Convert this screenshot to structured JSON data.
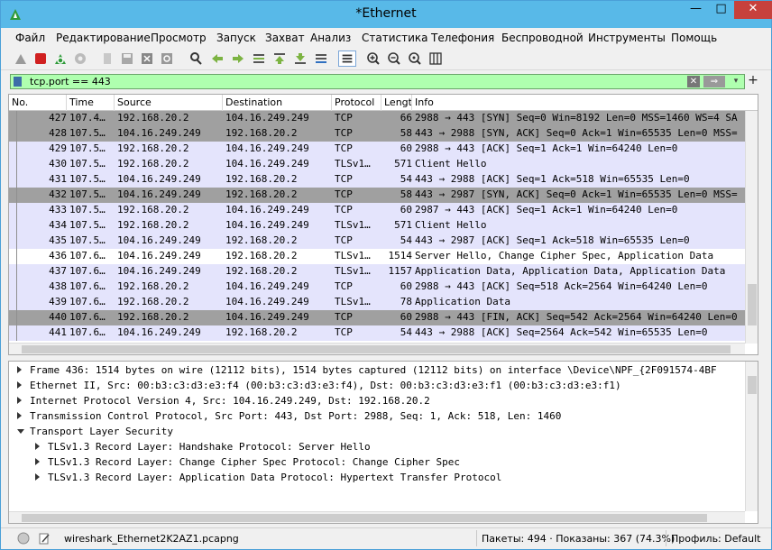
{
  "window": {
    "title": "*Ethernet",
    "minimize": "—",
    "maximize": "□",
    "close": "✕"
  },
  "menu": [
    "Файл",
    "Редактирование",
    "Просмотр",
    "Запуск",
    "Захват",
    "Анализ",
    "Статистика",
    "Телефония",
    "Беспроводной",
    "Инструменты",
    "Помощь"
  ],
  "toolbar_icons": [
    "shark-fin-start-icon",
    "stop-icon",
    "restart-icon",
    "options-icon",
    "open-file-icon",
    "save-icon",
    "close-file-icon",
    "reload-icon",
    "find-icon",
    "back-icon",
    "forward-icon",
    "go-to-packet-icon",
    "first-packet-icon",
    "last-packet-icon",
    "autoscroll-icon",
    "colorize-icon",
    "zoom-in-icon",
    "zoom-out-icon",
    "zoom-reset-icon",
    "resize-columns-icon"
  ],
  "filter": {
    "value": "tcp.port == 443",
    "clear": "✕",
    "apply": "⇒",
    "dropdown": "▾",
    "add": "+"
  },
  "columns": [
    "No.",
    "Time",
    "Source",
    "Destination",
    "Protocol",
    "Lengt",
    "Info"
  ],
  "packets": [
    {
      "no": "427",
      "time": "107.4…",
      "src": "192.168.20.2",
      "dst": "104.16.249.249",
      "proto": "TCP",
      "len": "66",
      "info": "2988 → 443 [SYN] Seq=0 Win=8192 Len=0 MSS=1460 WS=4 SA",
      "style": "dark"
    },
    {
      "no": "428",
      "time": "107.5…",
      "src": "104.16.249.249",
      "dst": "192.168.20.2",
      "proto": "TCP",
      "len": "58",
      "info": "443 → 2988 [SYN, ACK] Seq=0 Ack=1 Win=65535 Len=0 MSS=",
      "style": "dark"
    },
    {
      "no": "429",
      "time": "107.5…",
      "src": "192.168.20.2",
      "dst": "104.16.249.249",
      "proto": "TCP",
      "len": "60",
      "info": "2988 → 443 [ACK] Seq=1 Ack=1 Win=64240 Len=0",
      "style": "normal"
    },
    {
      "no": "430",
      "time": "107.5…",
      "src": "192.168.20.2",
      "dst": "104.16.249.249",
      "proto": "TLSv1…",
      "len": "571",
      "info": "Client Hello",
      "style": "normal"
    },
    {
      "no": "431",
      "time": "107.5…",
      "src": "104.16.249.249",
      "dst": "192.168.20.2",
      "proto": "TCP",
      "len": "54",
      "info": "443 → 2988 [ACK] Seq=1 Ack=518 Win=65535 Len=0",
      "style": "normal"
    },
    {
      "no": "432",
      "time": "107.5…",
      "src": "104.16.249.249",
      "dst": "192.168.20.2",
      "proto": "TCP",
      "len": "58",
      "info": "443 → 2987 [SYN, ACK] Seq=0 Ack=1 Win=65535 Len=0 MSS=",
      "style": "dark"
    },
    {
      "no": "433",
      "time": "107.5…",
      "src": "192.168.20.2",
      "dst": "104.16.249.249",
      "proto": "TCP",
      "len": "60",
      "info": "2987 → 443 [ACK] Seq=1 Ack=1 Win=64240 Len=0",
      "style": "normal"
    },
    {
      "no": "434",
      "time": "107.5…",
      "src": "192.168.20.2",
      "dst": "104.16.249.249",
      "proto": "TLSv1…",
      "len": "571",
      "info": "Client Hello",
      "style": "normal"
    },
    {
      "no": "435",
      "time": "107.5…",
      "src": "104.16.249.249",
      "dst": "192.168.20.2",
      "proto": "TCP",
      "len": "54",
      "info": "443 → 2987 [ACK] Seq=1 Ack=518 Win=65535 Len=0",
      "style": "normal"
    },
    {
      "no": "436",
      "time": "107.6…",
      "src": "104.16.249.249",
      "dst": "192.168.20.2",
      "proto": "TLSv1…",
      "len": "1514",
      "info": "Server Hello, Change Cipher Spec, Application Data",
      "style": "selected"
    },
    {
      "no": "437",
      "time": "107.6…",
      "src": "104.16.249.249",
      "dst": "192.168.20.2",
      "proto": "TLSv1…",
      "len": "1157",
      "info": "Application Data, Application Data, Application Data",
      "style": "normal"
    },
    {
      "no": "438",
      "time": "107.6…",
      "src": "192.168.20.2",
      "dst": "104.16.249.249",
      "proto": "TCP",
      "len": "60",
      "info": "2988 → 443 [ACK] Seq=518 Ack=2564 Win=64240 Len=0",
      "style": "normal"
    },
    {
      "no": "439",
      "time": "107.6…",
      "src": "192.168.20.2",
      "dst": "104.16.249.249",
      "proto": "TLSv1…",
      "len": "78",
      "info": "Application Data",
      "style": "normal"
    },
    {
      "no": "440",
      "time": "107.6…",
      "src": "192.168.20.2",
      "dst": "104.16.249.249",
      "proto": "TCP",
      "len": "60",
      "info": "2988 → 443 [FIN, ACK] Seq=542 Ack=2564 Win=64240 Len=0",
      "style": "dark"
    },
    {
      "no": "441",
      "time": "107.6…",
      "src": "104.16.249.249",
      "dst": "192.168.20.2",
      "proto": "TCP",
      "len": "54",
      "info": "443 → 2988 [ACK] Seq=2564 Ack=542 Win=65535 Len=0",
      "style": "normal"
    }
  ],
  "details": [
    {
      "text": "Frame 436: 1514 bytes on wire (12112 bits), 1514 bytes captured (12112 bits) on interface \\Device\\NPF_{2F091574-4BF",
      "expanded": false
    },
    {
      "text": "Ethernet II, Src: 00:b3:c3:d3:e3:f4 (00:b3:c3:d3:e3:f4), Dst: 00:b3:c3:d3:e3:f1 (00:b3:c3:d3:e3:f1)",
      "expanded": false
    },
    {
      "text": "Internet Protocol Version 4, Src: 104.16.249.249, Dst: 192.168.20.2",
      "expanded": false
    },
    {
      "text": "Transmission Control Protocol, Src Port: 443, Dst Port: 2988, Seq: 1, Ack: 518, Len: 1460",
      "expanded": false
    },
    {
      "text": "Transport Layer Security",
      "expanded": true
    },
    {
      "text": "TLSv1.3 Record Layer: Handshake Protocol: Server Hello",
      "expanded": false,
      "child": true
    },
    {
      "text": "TLSv1.3 Record Layer: Change Cipher Spec Protocol: Change Cipher Spec",
      "expanded": false,
      "child": true
    },
    {
      "text": "TLSv1.3 Record Layer: Application Data Protocol: Hypertext Transfer Protocol",
      "expanded": false,
      "child": true
    }
  ],
  "status": {
    "file": "wireshark_Ethernet2K2AZ1.pcapng",
    "packets": "Пакеты: 494 · Показаны: 367 (74.3%)",
    "profile": "Профиль: Default"
  }
}
